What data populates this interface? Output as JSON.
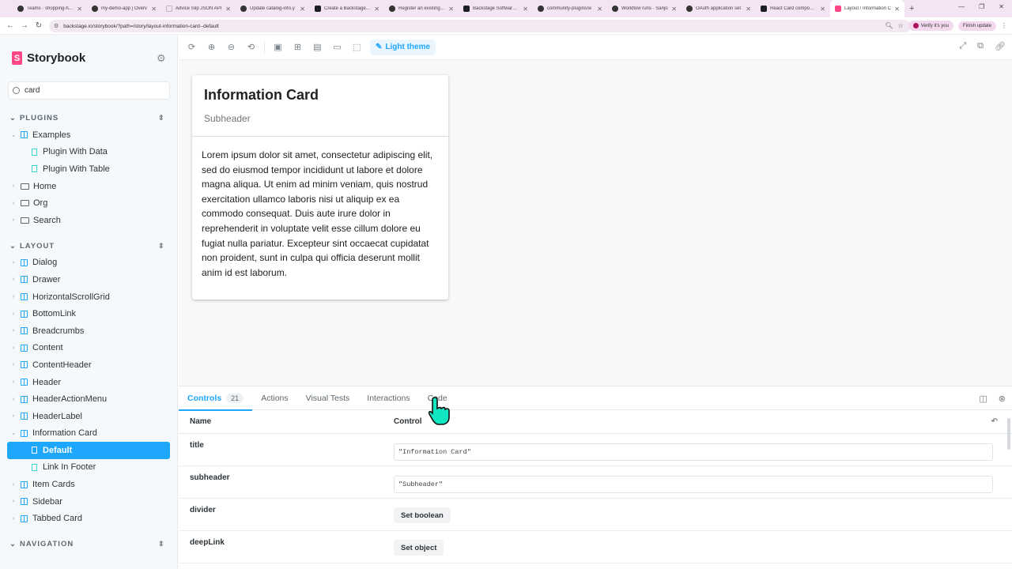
{
  "browser": {
    "tabs": [
      {
        "label": "Teams · shopping-hub",
        "icon": "github"
      },
      {
        "label": "my-demo-app | Overv",
        "icon": "github"
      },
      {
        "label": "Advice Slip JSON API",
        "icon": "blank"
      },
      {
        "label": "Update catalog-info.y",
        "icon": "github"
      },
      {
        "label": "Create a Backstage Pl",
        "icon": "backstage"
      },
      {
        "label": "Register an existing co",
        "icon": "github"
      },
      {
        "label": "Backstage Software Ca",
        "icon": "backstage"
      },
      {
        "label": "community-plugins/w",
        "icon": "github"
      },
      {
        "label": "Workflow runs · Sanjo",
        "icon": "github"
      },
      {
        "label": "OAuth application set",
        "icon": "github"
      },
      {
        "label": "React Card componen",
        "icon": "backstage"
      },
      {
        "label": "Layout / Information C",
        "icon": "storybook",
        "active": true
      }
    ],
    "url": "backstage.io/storybook/?path=/story/layout-information-card--default",
    "verify_label": "Verify it's you",
    "update_label": "Finish update"
  },
  "sidebar": {
    "brand": "Storybook",
    "search_value": "card",
    "plugins_section": "PLUGINS",
    "plugins": [
      {
        "label": "Examples",
        "kind": "component",
        "expanded": true,
        "depth": 0
      },
      {
        "label": "Plugin With Data",
        "kind": "story",
        "depth": 1
      },
      {
        "label": "Plugin With Table",
        "kind": "story",
        "depth": 1
      },
      {
        "label": "Home",
        "kind": "folder",
        "depth": 0
      },
      {
        "label": "Org",
        "kind": "folder",
        "depth": 0
      },
      {
        "label": "Search",
        "kind": "folder",
        "depth": 0
      }
    ],
    "layout_section": "LAYOUT",
    "layout": [
      {
        "label": "Dialog",
        "kind": "component",
        "depth": 0
      },
      {
        "label": "Drawer",
        "kind": "component",
        "depth": 0
      },
      {
        "label": "HorizontalScrollGrid",
        "kind": "component",
        "depth": 0
      },
      {
        "label": "BottomLink",
        "kind": "component",
        "depth": 0
      },
      {
        "label": "Breadcrumbs",
        "kind": "component",
        "depth": 0
      },
      {
        "label": "Content",
        "kind": "component",
        "depth": 0
      },
      {
        "label": "ContentHeader",
        "kind": "component",
        "depth": 0
      },
      {
        "label": "Header",
        "kind": "component",
        "depth": 0
      },
      {
        "label": "HeaderActionMenu",
        "kind": "component",
        "depth": 0
      },
      {
        "label": "HeaderLabel",
        "kind": "component",
        "depth": 0
      },
      {
        "label": "Information Card",
        "kind": "component",
        "expanded": true,
        "depth": 0
      },
      {
        "label": "Default",
        "kind": "story",
        "depth": 1,
        "selected": true
      },
      {
        "label": "Link In Footer",
        "kind": "story",
        "depth": 1
      },
      {
        "label": "Item Cards",
        "kind": "component",
        "depth": 0
      },
      {
        "label": "Sidebar",
        "kind": "component",
        "depth": 0
      },
      {
        "label": "Tabbed Card",
        "kind": "component",
        "depth": 0
      }
    ],
    "navigation_section": "NAVIGATION"
  },
  "toolbar": {
    "theme_label": "Light theme"
  },
  "card": {
    "title": "Information Card",
    "subheader": "Subheader",
    "body": "Lorem ipsum dolor sit amet, consectetur adipiscing elit, sed do eiusmod tempor incididunt ut labore et dolore magna aliqua. Ut enim ad minim veniam, quis nostrud exercitation ullamco laboris nisi ut aliquip ex ea commodo consequat. Duis aute irure dolor in reprehenderit in voluptate velit esse cillum dolore eu fugiat nulla pariatur. Excepteur sint occaecat cupidatat non proident, sunt in culpa qui officia deserunt mollit anim id est laborum."
  },
  "addons": {
    "tabs": [
      {
        "label": "Controls",
        "badge": "21",
        "active": true
      },
      {
        "label": "Actions"
      },
      {
        "label": "Visual Tests"
      },
      {
        "label": "Interactions"
      },
      {
        "label": "Code"
      }
    ],
    "col_name": "Name",
    "col_control": "Control",
    "controls": [
      {
        "name": "title",
        "type": "text",
        "value": "\"Information Card\""
      },
      {
        "name": "subheader",
        "type": "text",
        "value": "\"Subheader\""
      },
      {
        "name": "divider",
        "type": "button",
        "value": "Set boolean"
      },
      {
        "name": "deepLink",
        "type": "button",
        "value": "Set object"
      }
    ]
  },
  "colors": {
    "accent": "#1ea7fd",
    "brand": "#ff4785",
    "tab_strip": "#f5e4f3"
  }
}
